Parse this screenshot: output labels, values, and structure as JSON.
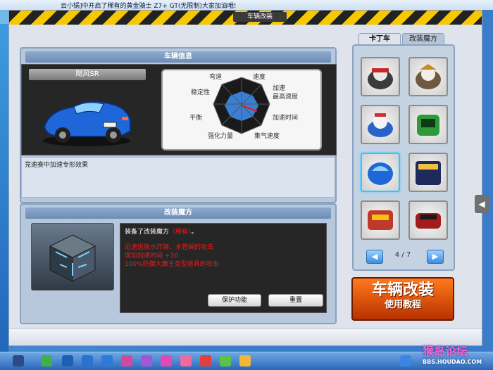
{
  "ticker": {
    "text": "云小锅]中开启了稀有的黄金骑士 Z7+ GT(无限制)大家加油哦!"
  },
  "window": {
    "title": "车辆改装"
  },
  "vehicle_info": {
    "header": "车辆信息",
    "car_name": "飓风SR",
    "stats": [
      "弯道",
      "速度",
      "加速",
      "最高速度",
      "加速时间",
      "集气速度",
      "强化力量",
      "平衡",
      "稳定性"
    ],
    "description": "竞速赛中加速专形效果"
  },
  "modify_magic": {
    "header": "改装魔方",
    "equipped_prefix": "装备了改装魔方",
    "equipped_name": "（稀有）",
    "equipped_suffix": "。",
    "effects": [
      "迅速逃脱水炸弹、水苍蝇的攻击",
      "增加加速时间 +30",
      "100%防御大魔王类型道具的攻击"
    ],
    "protect_button": "保护功能",
    "reset_button": "重置"
  },
  "right_panel": {
    "tabs": [
      "卡丁车",
      "改装魔方"
    ],
    "active_tab": 0,
    "page": "4 / 7",
    "prev_icon": "triangle-left-icon",
    "next_icon": "triangle-right-icon"
  },
  "promo": {
    "line1": "车辆改装",
    "line2": "使用教程"
  },
  "watermark": {
    "line1": "猴岛论坛",
    "line2": "BBS.HOUDAO.COM"
  },
  "colors": {
    "accent_red": "#e81c1c",
    "stat_fill": "#3a7fd6",
    "selected_border": "#2ec6ff"
  }
}
